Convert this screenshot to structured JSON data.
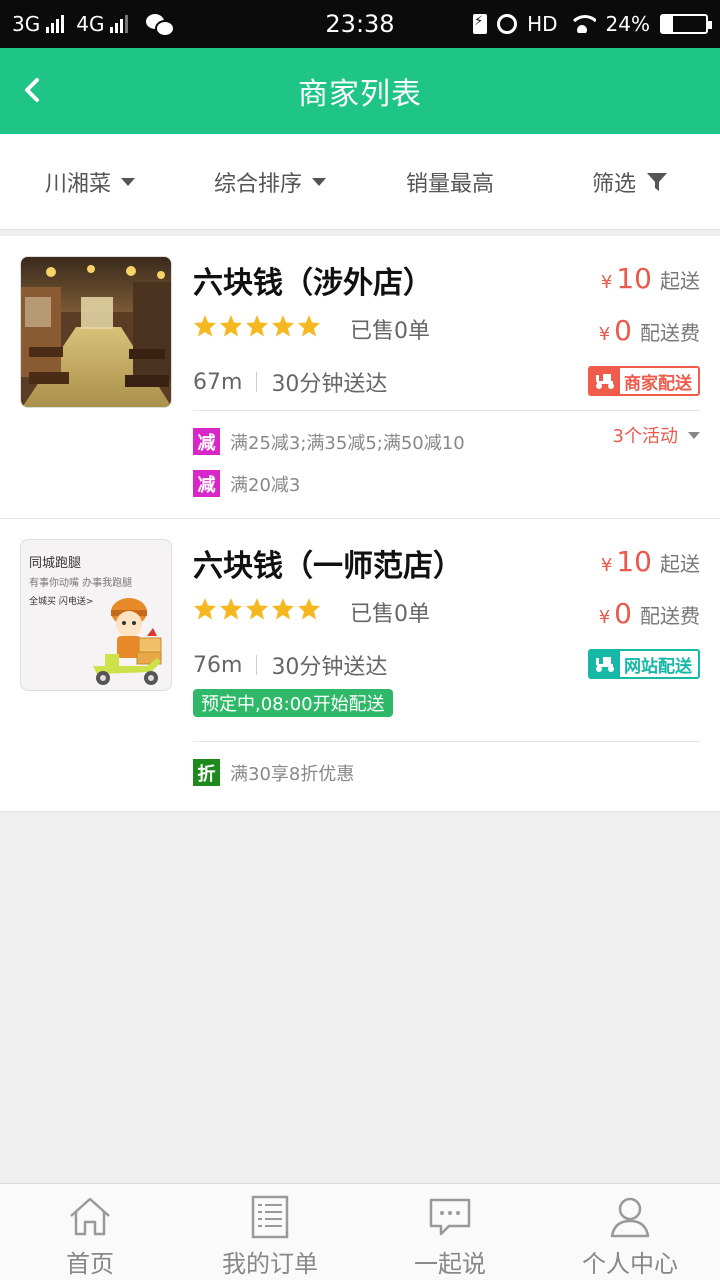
{
  "status_bar": {
    "network1": "3G",
    "network2": "4G",
    "time": "23:38",
    "hd": "HD",
    "battery": "24%",
    "battery_level": 0.24,
    "icons": [
      "signal-icon",
      "wechat-icon",
      "charging-icon",
      "alarm-icon",
      "wifi-icon",
      "battery-icon"
    ]
  },
  "header": {
    "title": "商家列表",
    "back_icon": "chevron-left-icon"
  },
  "filters": [
    {
      "label": "川湘菜",
      "icon": "caret-down-icon"
    },
    {
      "label": "综合排序",
      "icon": "caret-down-icon"
    },
    {
      "label": "销量最高"
    },
    {
      "label": "筛选",
      "icon": "funnel-icon"
    }
  ],
  "shops": [
    {
      "name": "六块钱（涉外店）",
      "rating": 5,
      "sold": "已售0单",
      "distance": "67m",
      "time": "30分钟送达",
      "currency": "¥",
      "min_order": "10",
      "min_order_unit": "起送",
      "delivery_fee": "0",
      "delivery_fee_unit": "配送费",
      "delivery_type": "商家配送",
      "activity_count": "3个活动",
      "promos": [
        {
          "badge": "减",
          "text": "满25减3;满35减5;满50减10"
        },
        {
          "badge": "减",
          "text": "满20减3"
        }
      ]
    },
    {
      "name": "六块钱（一师范店）",
      "rating": 5,
      "sold": "已售0单",
      "distance": "76m",
      "time": "30分钟送达",
      "currency": "¥",
      "min_order": "10",
      "min_order_unit": "起送",
      "delivery_fee": "0",
      "delivery_fee_unit": "配送费",
      "delivery_type": "网站配送",
      "preorder": "预定中,08:00开始配送",
      "thumb_text": {
        "title": "同城跑腿",
        "line1": "有事你动嘴 办事我跑腿",
        "line2": "全城买 闪电送>"
      },
      "promos": [
        {
          "badge": "折",
          "text": "满30享8折优惠"
        }
      ]
    }
  ],
  "bottom_nav": [
    {
      "label": "首页",
      "icon": "home-icon"
    },
    {
      "label": "我的订单",
      "icon": "order-list-icon"
    },
    {
      "label": "一起说",
      "icon": "chat-icon"
    },
    {
      "label": "个人中心",
      "icon": "person-icon"
    }
  ],
  "colors": {
    "brand_green": "#1ec586",
    "price_red": "#e85b4c",
    "star_yellow": "#f5b820",
    "merchant_delivery": "#ef5c4b",
    "site_delivery": "#16b9a6",
    "badge_jian": "#d926c9",
    "badge_zhe": "#1e8a1e",
    "preorder_green": "#2fb868"
  }
}
